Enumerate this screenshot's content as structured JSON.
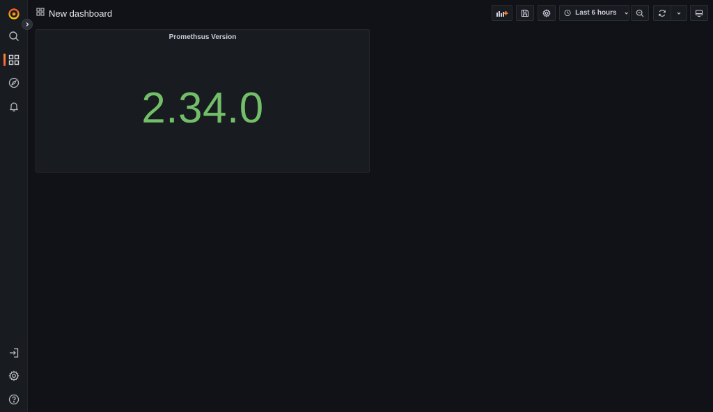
{
  "header": {
    "title": "New dashboard",
    "time_range_label": "Last 6 hours"
  },
  "sidebar": {
    "top_items": [
      "search",
      "dashboards",
      "explore",
      "alerting"
    ],
    "bottom_items": [
      "sign-in",
      "configuration",
      "help"
    ],
    "active": "dashboards"
  },
  "panel": {
    "title": "Promethsus Version",
    "value": "2.34.0",
    "value_color": "#73bf69"
  },
  "colors": {
    "background": "#111217",
    "panel_background": "#181b1f",
    "accent": "#f55f3e"
  }
}
